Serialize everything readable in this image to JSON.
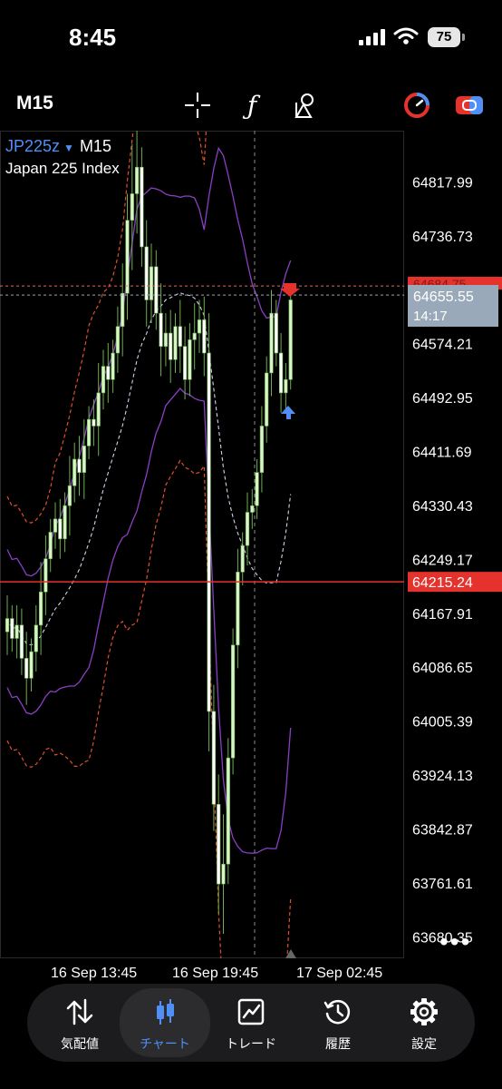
{
  "status_bar": {
    "time": "8:45",
    "battery": "75"
  },
  "toolbar": {
    "timeframe": "M15",
    "function_symbol": "ƒ"
  },
  "chart_header": {
    "symbol": "JP225z",
    "timeframe": "M15",
    "description": "Japan 225 Index"
  },
  "chart_data": {
    "type": "candlestick",
    "y_ticks": [
      "64817.99",
      "64736.73",
      "64655.55",
      "64574.21",
      "64492.95",
      "64411.69",
      "64330.43",
      "64249.17",
      "64167.91",
      "64086.65",
      "64005.39",
      "63924.13",
      "63842.87",
      "63761.61",
      "63680.35"
    ],
    "y_range": [
      63648,
      64895
    ],
    "x_ticks": [
      "16 Sep 13:45",
      "16 Sep 19:45",
      "17 Sep 02:45"
    ],
    "current_price": "64655.55",
    "countdown": "14:17",
    "hidden_price_label": "64684.75",
    "level_line": "64215.24",
    "level_value": 64215.24,
    "current_value": 64655.55
  },
  "nav": {
    "tabs": [
      {
        "label": "気配値"
      },
      {
        "label": "チャート"
      },
      {
        "label": "トレード"
      },
      {
        "label": "履歴"
      },
      {
        "label": "設定"
      }
    ]
  },
  "colors": {
    "accent": "#4f8ff7",
    "bull": "#d8f5c8",
    "bear": "#ffffff",
    "level": "#e5322d",
    "upper_band": "#e0502a",
    "inner_band": "#8a3fc4",
    "mid_band": "#cfd3e8"
  }
}
